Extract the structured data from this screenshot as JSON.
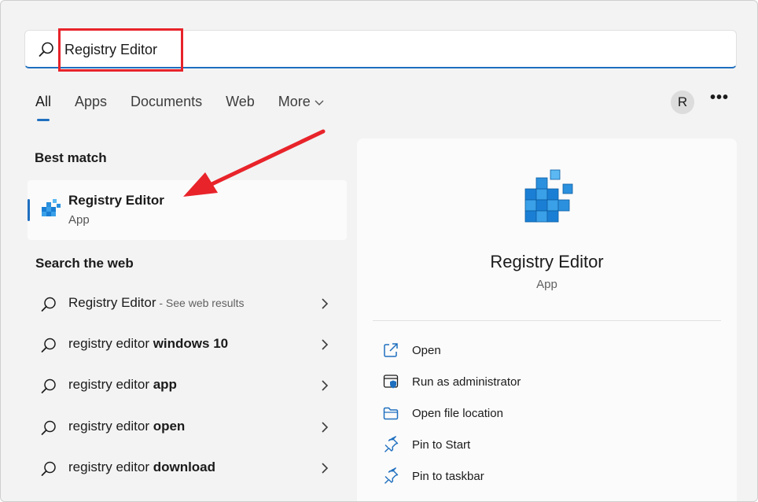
{
  "search": {
    "value": "Registry Editor"
  },
  "tabs": [
    {
      "label": "All",
      "active": true
    },
    {
      "label": "Apps"
    },
    {
      "label": "Documents"
    },
    {
      "label": "Web"
    },
    {
      "label": "More"
    }
  ],
  "user": {
    "avatar_initial": "R"
  },
  "more_options": "•••",
  "left": {
    "best_match_title": "Best match",
    "best_match": {
      "name": "Registry Editor",
      "type": "App",
      "icon": "registry-cubes-icon"
    },
    "search_web_title": "Search the web",
    "web_results": [
      {
        "prefix": "Registry Editor",
        "bold": "",
        "suffix": " - See web results"
      },
      {
        "prefix": "registry editor ",
        "bold": "windows 10",
        "suffix": ""
      },
      {
        "prefix": "registry editor ",
        "bold": "app",
        "suffix": ""
      },
      {
        "prefix": "registry editor ",
        "bold": "open",
        "suffix": ""
      },
      {
        "prefix": "registry editor ",
        "bold": "download",
        "suffix": ""
      }
    ]
  },
  "detail": {
    "title": "Registry Editor",
    "subtitle": "App",
    "actions": [
      {
        "label": "Open",
        "icon": "open-external-icon"
      },
      {
        "label": "Run as administrator",
        "icon": "shield-icon"
      },
      {
        "label": "Open file location",
        "icon": "folder-icon"
      },
      {
        "label": "Pin to Start",
        "icon": "pin-icon"
      },
      {
        "label": "Pin to taskbar",
        "icon": "pin-icon"
      }
    ]
  },
  "colors": {
    "accent": "#1f6fbf",
    "annotation_red": "#e8232a",
    "background": "#f3f3f3"
  }
}
